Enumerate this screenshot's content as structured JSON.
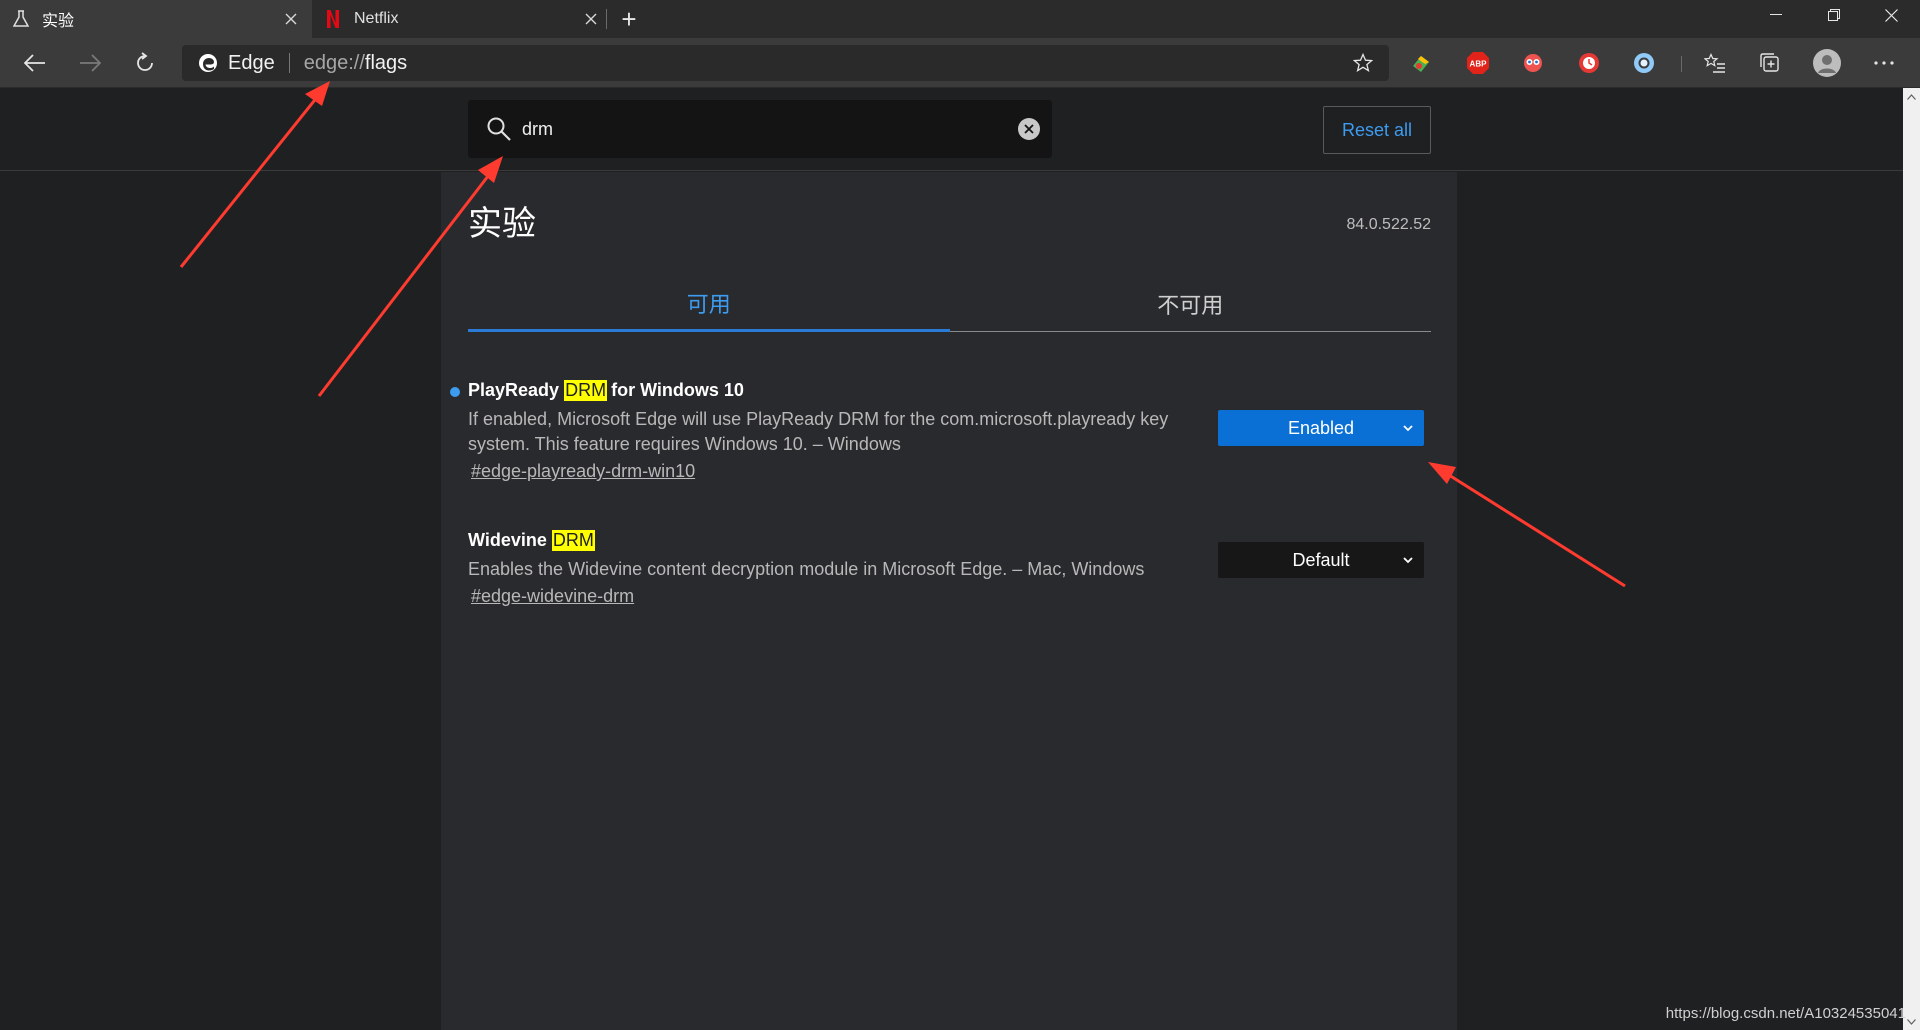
{
  "browser": {
    "tabs": [
      {
        "title": "实验",
        "icon": "flask-icon",
        "active": true
      },
      {
        "title": "Netflix",
        "icon": "netflix-icon",
        "active": false
      }
    ],
    "new_tab_label": "+",
    "omnibox": {
      "brand": "Edge",
      "url_scheme": "edge://",
      "url_path": "flags"
    },
    "extensions": [
      "extension-icon",
      "adblock-plus-icon",
      "extension-icon",
      "extension-icon",
      "extension-icon"
    ],
    "adblock_label": "ABP"
  },
  "flags_page": {
    "search": {
      "value": "drm"
    },
    "reset_label": "Reset all",
    "title": "实验",
    "version": "84.0.522.52",
    "tabs": [
      {
        "label": "可用",
        "active": true
      },
      {
        "label": "不可用",
        "active": false
      }
    ],
    "flags": [
      {
        "title_before": "PlayReady",
        "title_highlight": "DRM",
        "title_after": "for Windows 10",
        "description": "If enabled, Microsoft Edge will use PlayReady DRM for the com.microsoft.playready key system. This feature requires Windows 10. – Windows",
        "link": "#edge-playready-drm-win10",
        "value": "Enabled",
        "modified": true
      },
      {
        "title_before": "Widevine",
        "title_highlight": "DRM",
        "title_after": "",
        "description": "Enables the Widevine content decryption module in Microsoft Edge. – Mac, Windows",
        "link": "#edge-widevine-drm",
        "value": "Default",
        "modified": false
      }
    ]
  },
  "watermark": "https://blog.csdn.net/A10324535041",
  "colors": {
    "accent": "#3d9bf0",
    "enabled_select": "#0a70d6",
    "highlight": "#ffff00",
    "annotation_arrow": "#ff3b30"
  }
}
